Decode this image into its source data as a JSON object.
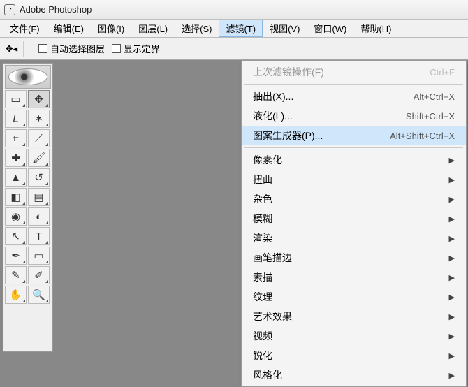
{
  "title": "Adobe Photoshop",
  "menubar": [
    {
      "label": "文件(F)"
    },
    {
      "label": "编辑(E)"
    },
    {
      "label": "图像(I)"
    },
    {
      "label": "图层(L)"
    },
    {
      "label": "选择(S)"
    },
    {
      "label": "滤镜(T)",
      "active": true
    },
    {
      "label": "视图(V)"
    },
    {
      "label": "窗口(W)"
    },
    {
      "label": "帮助(H)"
    }
  ],
  "options": {
    "auto_select_layer": "自动选择图层",
    "show_bounds": "显示定界"
  },
  "dropdown": [
    {
      "label": "上次滤镜操作(F)",
      "shortcut": "Ctrl+F",
      "disabled": true
    },
    {
      "sep": true
    },
    {
      "label": "抽出(X)...",
      "shortcut": "Alt+Ctrl+X"
    },
    {
      "label": "液化(L)...",
      "shortcut": "Shift+Ctrl+X"
    },
    {
      "label": "图案生成器(P)...",
      "shortcut": "Alt+Shift+Ctrl+X",
      "hover": true
    },
    {
      "sep": true
    },
    {
      "label": "像素化",
      "submenu": true
    },
    {
      "label": "扭曲",
      "submenu": true
    },
    {
      "label": "杂色",
      "submenu": true
    },
    {
      "label": "模糊",
      "submenu": true
    },
    {
      "label": "渲染",
      "submenu": true
    },
    {
      "label": "画笔描边",
      "submenu": true
    },
    {
      "label": "素描",
      "submenu": true
    },
    {
      "label": "纹理",
      "submenu": true
    },
    {
      "label": "艺术效果",
      "submenu": true
    },
    {
      "label": "视频",
      "submenu": true
    },
    {
      "label": "锐化",
      "submenu": true
    },
    {
      "label": "风格化",
      "submenu": true
    }
  ],
  "tools": [
    [
      "marquee",
      "move"
    ],
    [
      "lasso",
      "wand"
    ],
    [
      "crop",
      "slice"
    ],
    [
      "heal",
      "brush"
    ],
    [
      "stamp",
      "history"
    ],
    [
      "eraser",
      "gradient"
    ],
    [
      "blur",
      "dodge"
    ],
    [
      "path",
      "type"
    ],
    [
      "pen",
      "shape"
    ],
    [
      "notes",
      "eyedrop"
    ],
    [
      "hand",
      "zoom"
    ]
  ],
  "tool_glyphs": {
    "marquee": "▭",
    "move": "✥",
    "lasso": "𝘓",
    "wand": "✶",
    "crop": "⌗",
    "slice": "⟋",
    "heal": "✚",
    "brush": "🖌",
    "stamp": "▲",
    "history": "↺",
    "eraser": "◧",
    "gradient": "▤",
    "blur": "◉",
    "dodge": "◐",
    "path": "↖",
    "type": "T",
    "pen": "✒",
    "shape": "▭",
    "notes": "✎",
    "eyedrop": "✐",
    "hand": "✋",
    "zoom": "🔍"
  }
}
